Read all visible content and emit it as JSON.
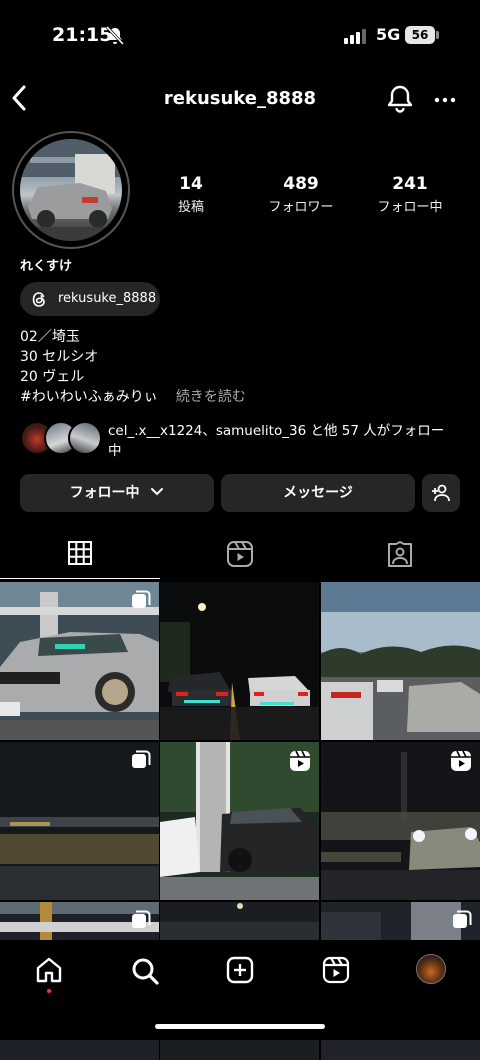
{
  "status_bar": {
    "time": "21:15",
    "network": "5G",
    "battery": "56"
  },
  "header": {
    "username": "rekusuke_8888"
  },
  "profile": {
    "stats": [
      {
        "value": "14",
        "label": "投稿"
      },
      {
        "value": "489",
        "label": "フォロワー"
      },
      {
        "value": "241",
        "label": "フォロー中"
      }
    ],
    "full_name": "れくすけ",
    "threads_handle": "rekusuke_8888",
    "bio_lines": [
      "02／埼玉",
      "30 セルシオ",
      "20 ヴェル",
      "#わいわいふぁみりぃ"
    ],
    "more_label": "続きを読む",
    "followed_by_line1": "cel_.x__x1224、samuelito_36 と他 57 人がフォロー",
    "followed_by_line2": "中"
  },
  "actions": {
    "follow": "フォロー中",
    "message": "メッセージ"
  },
  "tabs": [
    "posts-grid",
    "reels",
    "tagged"
  ],
  "grid_items": [
    {
      "badge": "carousel"
    },
    {
      "badge": ""
    },
    {
      "badge": ""
    },
    {
      "badge": "carousel"
    },
    {
      "badge": "reel"
    },
    {
      "badge": "reel"
    },
    {
      "badge": "carousel"
    },
    {
      "badge": ""
    },
    {
      "badge": "carousel"
    }
  ],
  "colors": {
    "background": "#000000",
    "button": "#262626",
    "notify_dot": "#ff3040"
  }
}
